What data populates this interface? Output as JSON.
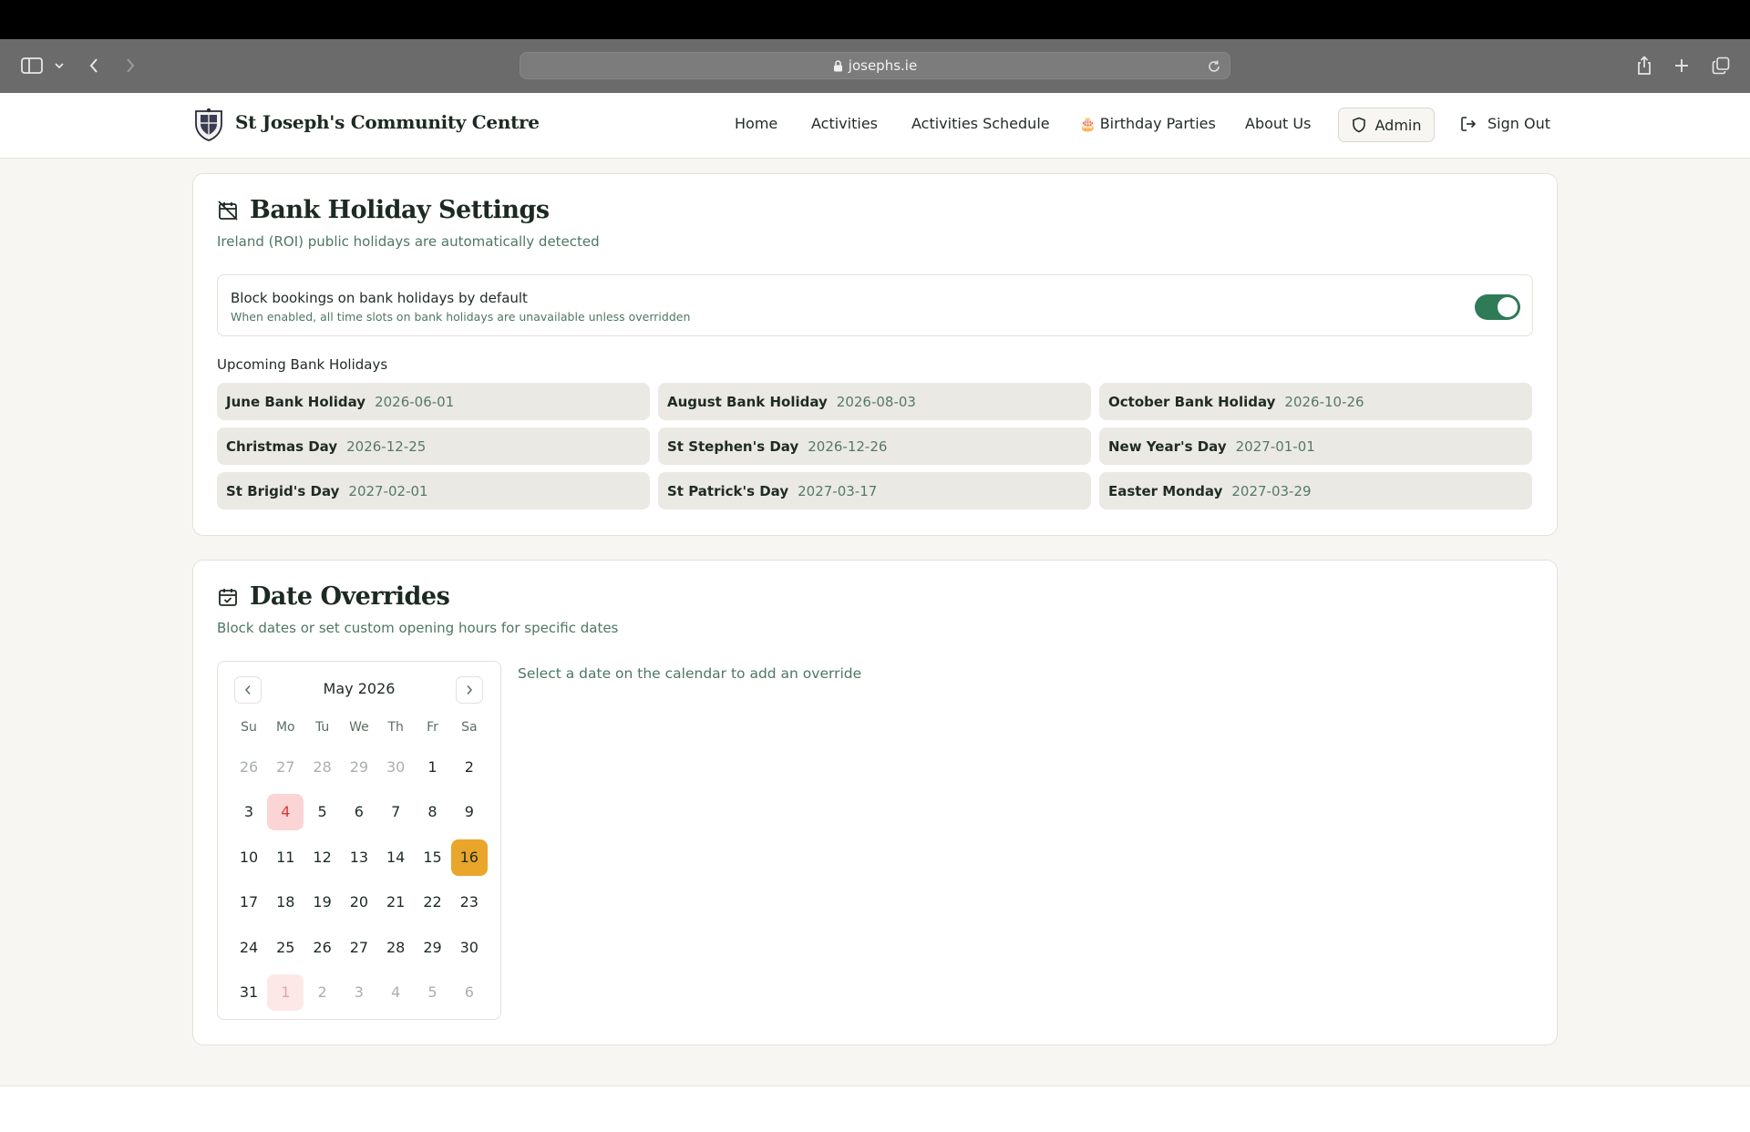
{
  "browser": {
    "url": "josephs.ie"
  },
  "nav": {
    "brand": "St Joseph's Community Centre",
    "links": [
      {
        "label": "Home"
      },
      {
        "label": "Activities"
      },
      {
        "label": "Activities Schedule"
      },
      {
        "label": "Birthday Parties",
        "emoji": "🎂"
      },
      {
        "label": "About Us"
      }
    ],
    "admin_label": "Admin",
    "signout_label": "Sign Out"
  },
  "bank_holidays": {
    "title": "Bank Holiday Settings",
    "subtitle": "Ireland (ROI) public holidays are automatically detected",
    "toggle": {
      "title": "Block bookings on bank holidays by default",
      "description": "When enabled, all time slots on bank holidays are unavailable unless overridden",
      "enabled": true
    },
    "upcoming_label": "Upcoming Bank Holidays",
    "list": [
      {
        "name": "June Bank Holiday",
        "date": "2026-06-01"
      },
      {
        "name": "August Bank Holiday",
        "date": "2026-08-03"
      },
      {
        "name": "October Bank Holiday",
        "date": "2026-10-26"
      },
      {
        "name": "Christmas Day",
        "date": "2026-12-25"
      },
      {
        "name": "St Stephen's Day",
        "date": "2026-12-26"
      },
      {
        "name": "New Year's Day",
        "date": "2027-01-01"
      },
      {
        "name": "St Brigid's Day",
        "date": "2027-02-01"
      },
      {
        "name": "St Patrick's Day",
        "date": "2027-03-17"
      },
      {
        "name": "Easter Monday",
        "date": "2027-03-29"
      }
    ]
  },
  "overrides": {
    "title": "Date Overrides",
    "subtitle": "Block dates or set custom opening hours for specific dates",
    "hint": "Select a date on the calendar to add an override",
    "calendar": {
      "month_label": "May 2026",
      "weekdays": [
        "Su",
        "Mo",
        "Tu",
        "We",
        "Th",
        "Fr",
        "Sa"
      ],
      "weeks": [
        [
          {
            "d": "26",
            "m": true
          },
          {
            "d": "27",
            "m": true
          },
          {
            "d": "28",
            "m": true
          },
          {
            "d": "29",
            "m": true
          },
          {
            "d": "30",
            "m": true
          },
          {
            "d": "1"
          },
          {
            "d": "2"
          }
        ],
        [
          {
            "d": "3"
          },
          {
            "d": "4",
            "h": true
          },
          {
            "d": "5"
          },
          {
            "d": "6"
          },
          {
            "d": "7"
          },
          {
            "d": "8"
          },
          {
            "d": "9"
          }
        ],
        [
          {
            "d": "10"
          },
          {
            "d": "11"
          },
          {
            "d": "12"
          },
          {
            "d": "13"
          },
          {
            "d": "14"
          },
          {
            "d": "15"
          },
          {
            "d": "16",
            "t": true
          }
        ],
        [
          {
            "d": "17"
          },
          {
            "d": "18"
          },
          {
            "d": "19"
          },
          {
            "d": "20"
          },
          {
            "d": "21"
          },
          {
            "d": "22"
          },
          {
            "d": "23"
          }
        ],
        [
          {
            "d": "24"
          },
          {
            "d": "25"
          },
          {
            "d": "26"
          },
          {
            "d": "27"
          },
          {
            "d": "28"
          },
          {
            "d": "29"
          },
          {
            "d": "30"
          }
        ],
        [
          {
            "d": "31"
          },
          {
            "d": "1",
            "m": true,
            "h": true
          },
          {
            "d": "2",
            "m": true
          },
          {
            "d": "3",
            "m": true
          },
          {
            "d": "4",
            "m": true
          },
          {
            "d": "5",
            "m": true
          },
          {
            "d": "6",
            "m": true
          }
        ]
      ]
    }
  },
  "colors": {
    "accent_green": "#2f7a57",
    "today_orange": "#e9a62b",
    "holiday_red": "#d33a3a"
  }
}
